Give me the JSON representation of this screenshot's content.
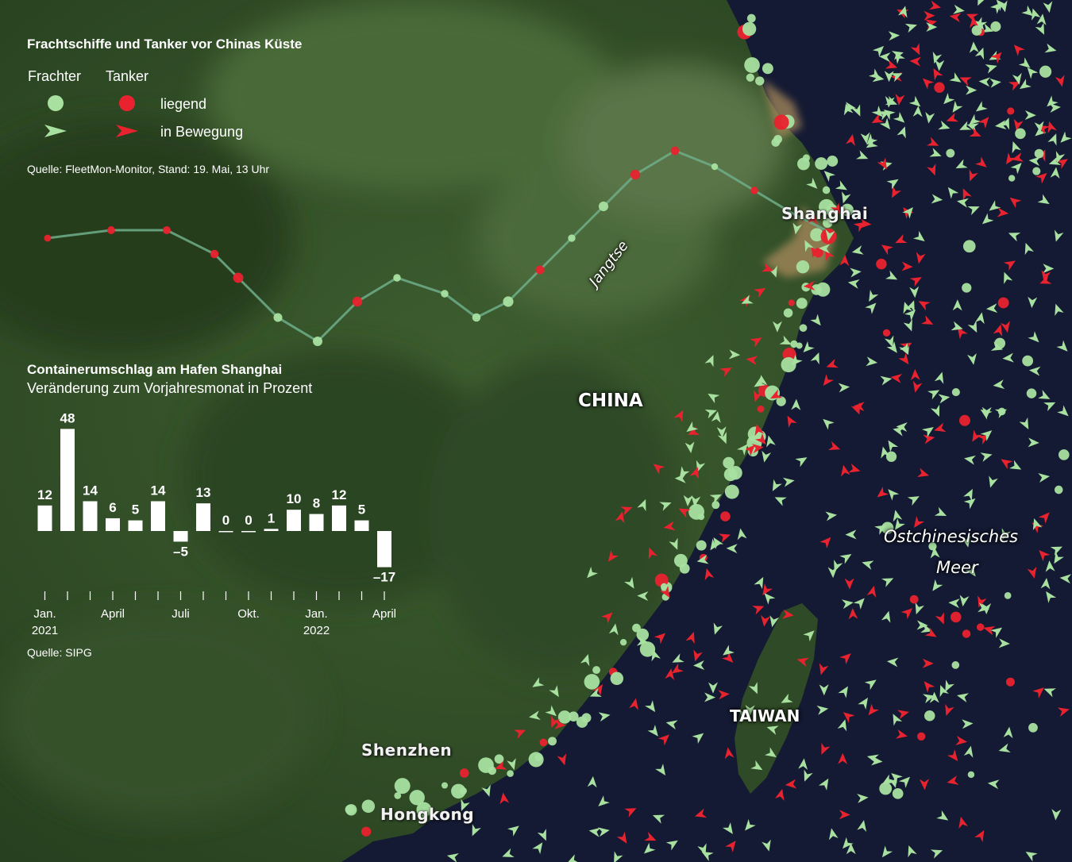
{
  "legend": {
    "title": "Frachtschiffe und Tanker vor Chinas Küste",
    "col_frachter": "Frachter",
    "col_tanker": "Tanker",
    "row_liegend": "liegend",
    "row_bewegung": "in Bewegung",
    "source": "Quelle: FleetMon-Monitor, Stand: 19. Mai, 13 Uhr",
    "colors": {
      "frachter": "#a8e0a0",
      "tanker": "#e8222e"
    }
  },
  "map_labels": {
    "shanghai": "Shanghai",
    "jangtse": "Jangtse",
    "china": "CHINA",
    "ostchinesisches": "Ostchinesisches",
    "meer": "Meer",
    "taiwan": "TAIWAN",
    "shenzhen": "Shenzhen",
    "hongkong": "Hongkong"
  },
  "chart_data": {
    "type": "bar",
    "title": "Containerumschlag am Hafen Shanghai",
    "subtitle": "Veränderung zum Vorjahresmonat in Prozent",
    "source": "Quelle: SIPG",
    "values": [
      12,
      48,
      14,
      6,
      5,
      14,
      -5,
      13,
      0,
      0,
      1,
      10,
      8,
      12,
      5,
      -17
    ],
    "value_labels": [
      "12",
      "48",
      "14",
      "6",
      "5",
      "14",
      "–5",
      "13",
      "0",
      "0",
      "1",
      "10",
      "8",
      "12",
      "5",
      "–17"
    ],
    "tick_labels": [
      {
        "month_index": 0,
        "lines": [
          "Jan.",
          "2021"
        ]
      },
      {
        "month_index": 3,
        "lines": [
          "April"
        ]
      },
      {
        "month_index": 6,
        "lines": [
          "Juli"
        ]
      },
      {
        "month_index": 9,
        "lines": [
          "Okt."
        ]
      },
      {
        "month_index": 12,
        "lines": [
          "Jan.",
          "2022"
        ]
      },
      {
        "month_index": 15,
        "lines": [
          "April"
        ]
      }
    ],
    "bar_color": "#ffffff"
  }
}
